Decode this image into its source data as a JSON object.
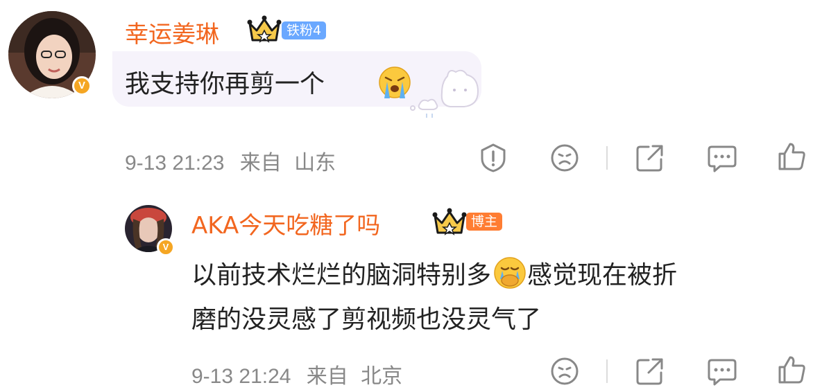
{
  "comment1": {
    "username": "幸运姜琳",
    "verified_badge": "V",
    "fan_tag": "铁粉4",
    "text": "我支持你再剪一个",
    "emoji": "crying-face",
    "timestamp": "9-13 21:23",
    "from_label": "来自",
    "location": "山东",
    "actions": [
      "report",
      "dislike",
      "share",
      "comment",
      "like"
    ]
  },
  "comment2": {
    "username": "AKA今天吃糖了吗",
    "verified_badge": "V",
    "author_tag": "博主",
    "text_line1_a": "以前技术烂烂的脑洞特别多",
    "emoji": "crying-cover-mouth-face",
    "text_line1_b": "感觉现在被折",
    "text_line2": "磨的没灵感了剪视频也没灵气了",
    "timestamp": "9-13 21:24",
    "from_label": "来自",
    "location": "北京",
    "actions": [
      "dislike",
      "share",
      "comment",
      "like"
    ]
  },
  "colors": {
    "username": "#f2661f",
    "meta_gray": "#888888",
    "fan_tag": "#6aa8ff",
    "author_tag": "#ff7d33",
    "verified": "#f5a623"
  }
}
